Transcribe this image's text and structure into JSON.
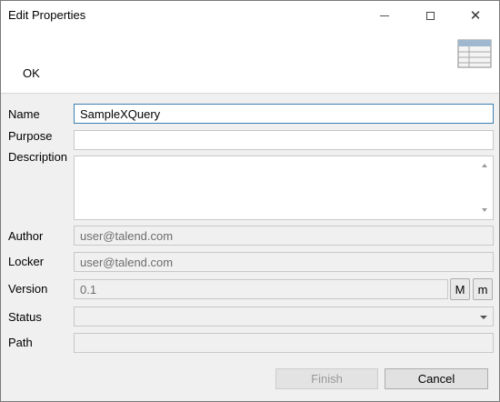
{
  "window": {
    "title": "Edit Properties",
    "minimize_icon": "minimize-icon",
    "maximize_icon": "maximize-icon",
    "close_icon": "close-icon"
  },
  "banner": {
    "ok_label": "OK",
    "icon": "table-icon"
  },
  "form": {
    "name_label": "Name",
    "name_value": "SampleXQuery",
    "purpose_label": "Purpose",
    "purpose_value": "",
    "description_label": "Description",
    "description_value": "",
    "author_label": "Author",
    "author_value": "user@talend.com",
    "locker_label": "Locker",
    "locker_value": "user@talend.com",
    "version_label": "Version",
    "version_value": "0.1",
    "version_major_btn": "M",
    "version_minor_btn": "m",
    "status_label": "Status",
    "status_value": "",
    "path_label": "Path",
    "path_value": ""
  },
  "footer": {
    "finish_label": "Finish",
    "cancel_label": "Cancel"
  },
  "colors": {
    "focus_border": "#3c7fb1",
    "dialog_bg": "#f0f0f0"
  }
}
